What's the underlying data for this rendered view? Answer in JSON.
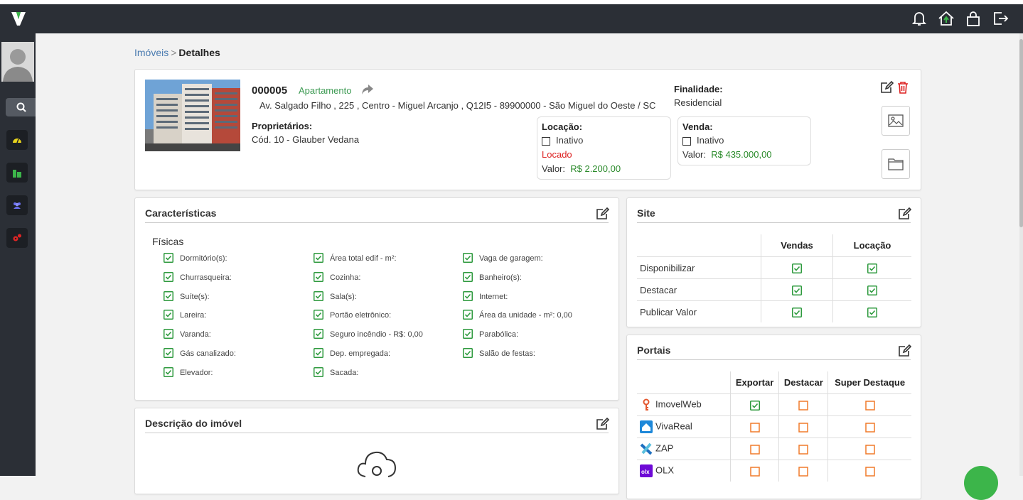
{
  "breadcrumb": {
    "link": "Imóveis",
    "separator": ">",
    "current": "Detalhes"
  },
  "property": {
    "code": "000005",
    "type": "Apartamento",
    "address": "Av. Salgado Filho , 225 , Centro - Miguel Arcanjo , Q12I5 - 89900000 - São Miguel do Oeste / SC",
    "owners_label": "Proprietários:",
    "owner": "Cód. 10 - Glauber Vedana",
    "purpose_label": "Finalidade:",
    "purpose": "Residencial",
    "rental": {
      "label": "Locação:",
      "status": "Inativo",
      "extra": "Locado",
      "value_label": "Valor:",
      "value": "R$ 2.200,00"
    },
    "sale": {
      "label": "Venda:",
      "status": "Inativo",
      "value_label": "Valor:",
      "value": "R$ 435.000,00"
    }
  },
  "features": {
    "title": "Características",
    "subtitle": "Físicas",
    "items": [
      "Dormitório(s):",
      "Churrasqueira:",
      "Suíte(s):",
      "Lareira:",
      "Varanda:",
      "Gás canalizado:",
      "Elevador:",
      "Área total edif - m²:",
      "Cozinha:",
      "Sala(s):",
      "Portão eletrônico:",
      "Seguro incêndio - R$:   0,00",
      "Dep. empregada:",
      "Sacada:",
      "Vaga de garagem:",
      "Banheiro(s):",
      "Internet:",
      "Área da unidade - m²:   0,00",
      "Parabólica:",
      "Salão de festas:"
    ]
  },
  "description": {
    "title": "Descrição do imóvel"
  },
  "site": {
    "title": "Site",
    "columns": [
      "Vendas",
      "Locação"
    ],
    "rows": [
      {
        "label": "Disponibilizar",
        "values": [
          true,
          true
        ]
      },
      {
        "label": "Destacar",
        "values": [
          true,
          true
        ]
      },
      {
        "label": "Publicar Valor",
        "values": [
          true,
          true
        ]
      }
    ]
  },
  "portals": {
    "title": "Portais",
    "columns": [
      "Exportar",
      "Destacar",
      "Super Destaque"
    ],
    "rows": [
      {
        "name": "ImovelWeb",
        "icon": "imovelweb-icon",
        "values": [
          true,
          false,
          false
        ]
      },
      {
        "name": "VivaReal",
        "icon": "vivareal-icon",
        "values": [
          false,
          false,
          false
        ]
      },
      {
        "name": "ZAP",
        "icon": "zap-icon",
        "values": [
          false,
          false,
          false
        ]
      },
      {
        "name": "OLX",
        "icon": "olx-icon",
        "values": [
          false,
          false,
          false
        ]
      }
    ]
  },
  "colors": {
    "topbar": "#2b2f36",
    "accent_green": "#3c9a52",
    "danger": "#d22222",
    "orange_box": "#f07a2a"
  }
}
